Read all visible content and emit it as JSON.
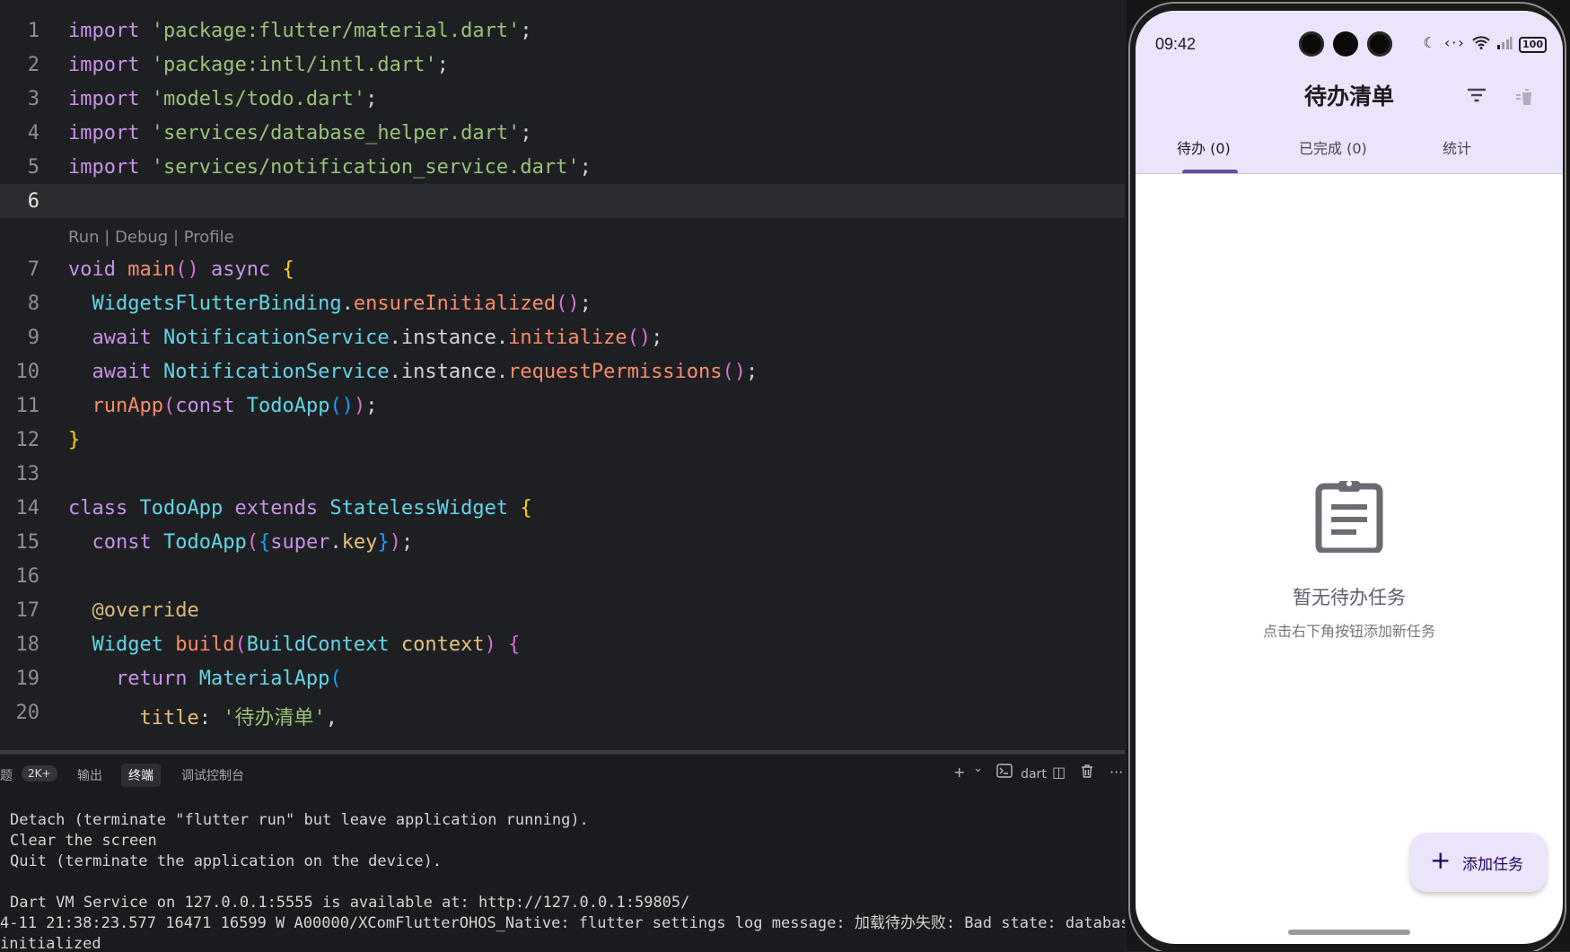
{
  "editor": {
    "codelens": "Run | Debug | Profile",
    "lines": [
      {
        "n": "1"
      },
      {
        "n": "2"
      },
      {
        "n": "3"
      },
      {
        "n": "4"
      },
      {
        "n": "5"
      },
      {
        "n": "6"
      },
      {
        "n": "7"
      },
      {
        "n": "8"
      },
      {
        "n": "9"
      },
      {
        "n": "10"
      },
      {
        "n": "11"
      },
      {
        "n": "12"
      },
      {
        "n": "13"
      },
      {
        "n": "14"
      },
      {
        "n": "15"
      },
      {
        "n": "16"
      },
      {
        "n": "17"
      },
      {
        "n": "18"
      },
      {
        "n": "19"
      },
      {
        "n": "20"
      }
    ],
    "code": {
      "import_kw": "import",
      "imports": [
        "'package:flutter/material.dart'",
        "'package:intl/intl.dart'",
        "'models/todo.dart'",
        "'services/database_helper.dart'",
        "'services/notification_service.dart'"
      ],
      "semi": ";",
      "void": "void",
      "main": "main",
      "async": "async",
      "widgets_binding": "WidgetsFlutterBinding",
      "ensure_initialized": "ensureInitialized",
      "await": "await",
      "notification_service": "NotificationService",
      "instance": "instance",
      "initialize": "initialize",
      "request_permissions": "requestPermissions",
      "run_app": "runApp",
      "const": "const",
      "todo_app": "TodoApp",
      "class": "class",
      "extends": "extends",
      "stateless_widget": "StatelessWidget",
      "super": "super",
      "key": "key",
      "override": "@override",
      "widget": "Widget",
      "build": "build",
      "build_context": "BuildContext",
      "context": "context",
      "return": "return",
      "material_app": "MaterialApp",
      "title_prop": "title",
      "title_value": "'待办清单'"
    }
  },
  "panel": {
    "tabs": [
      {
        "label": "题"
      },
      {
        "label": "输出"
      },
      {
        "label": "终端"
      },
      {
        "label": "调试控制台"
      }
    ],
    "problems_badge": "2K+",
    "tools": {
      "add": "+",
      "chevron": "⌄",
      "shell_label": "dart",
      "split": "◫",
      "trash": "🗑",
      "more": "···"
    },
    "terminal_lines": [
      "Detach (terminate \"flutter run\" but leave application running).",
      "Clear the screen",
      "Quit (terminate the application on the device).",
      "",
      "Dart VM Service on 127.0.0.1:5555 is available at: http://127.0.0.1:59805/",
      "4-11 21:38:23.577 16471 16599 W A00000/XComFlutterOHOS_Native: flutter settings log message: 加载待办失败: Bad state: database",
      "initialized"
    ]
  },
  "phone": {
    "status": {
      "time": "09:42",
      "battery": "100"
    },
    "app_title": "待办清单",
    "actions": {
      "filter_icon": "filter-icon",
      "delete_icon": "delete-sweep-icon"
    },
    "tabs": [
      {
        "label": "待办 (0)"
      },
      {
        "label": "已完成 (0)"
      },
      {
        "label": "统计"
      }
    ],
    "empty": {
      "title": "暂无待办任务",
      "subtitle": "点击右下角按钮添加新任务"
    },
    "fab_label": "添加任务",
    "colors": {
      "surface": "#ebe4fb",
      "primary": "#6750a4"
    }
  }
}
